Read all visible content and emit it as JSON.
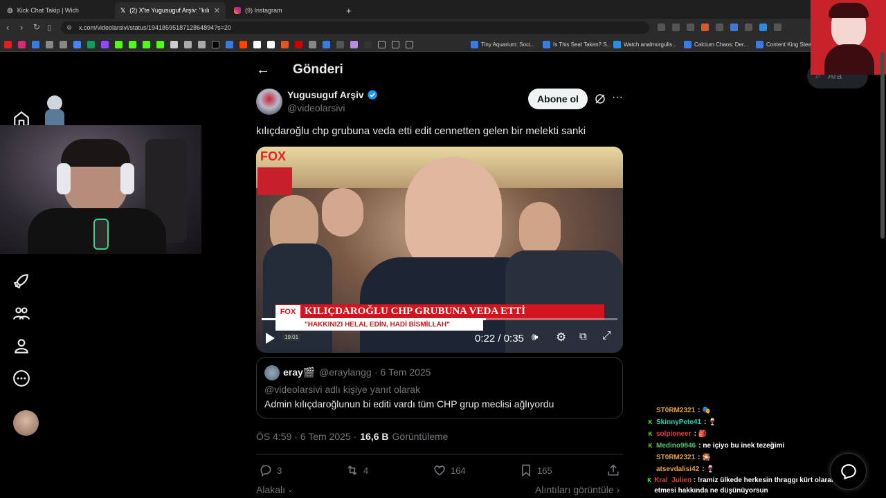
{
  "browser": {
    "tabs": [
      {
        "title": "Kick Chat Takip | Wich",
        "active": false
      },
      {
        "title": "(2) X'te Yugusuguf Arşiv: \"kılıçda",
        "active": true
      },
      {
        "title": "(9) Instagram",
        "active": false
      }
    ],
    "new_tab": "+",
    "url": "x.com/videolarsivi/status/1941859518712864894?s=20",
    "bookmarks": [
      {
        "label": "Tiny Aquarium: Soci..."
      },
      {
        "label": "Is This Seat Taken? S..."
      },
      {
        "label": "Watch analmorgulis..."
      },
      {
        "label": "Calcium Chaos: Der..."
      },
      {
        "label": "Content King Stean"
      }
    ]
  },
  "colors": {
    "accent": "#1d9bf0",
    "verified": "#1d9bf0",
    "muted": "#71767b",
    "red_banner": "#d3141e",
    "portrait_red": "#c8232a"
  },
  "header": {
    "back_icon": "arrow-left-icon",
    "title": "Gönderi"
  },
  "search": {
    "placeholder": "Ara"
  },
  "post": {
    "author_name": "Yugusuguf Arşiv",
    "author_handle": "@videolarsivi",
    "subscribe_label": "Abone ol",
    "text": "kılıçdaroğlu chp grubuna veda etti edit cennetten gelen bir melekti sanki",
    "video": {
      "channel_logo": "FOX",
      "banner_title": "KILIÇDAROĞLU CHP GRUBUNA VEDA ETTİ",
      "banner_subtitle": "\"HAKKINIZI HELAL EDİN, HADİ BİSMİLLAH\"",
      "clock": "19:01",
      "time": "0:22 / 0:35",
      "progress": 0.63
    },
    "quote": {
      "name": "eray🎬",
      "handle": "@eraylangg",
      "date": "· 6 Tem 2025",
      "reply_to": "@videolarsivi adlı kişiye yanıt olarak",
      "text": "Admin kılıçdaroğlunun bi editi vardı tüm CHP grup meclisi ağlıyordu"
    },
    "timestamp": "ÖS 4:59 · 6 Tem 2025 ·",
    "views_count": "16,6 B",
    "views_label": "Görüntüleme",
    "actions": {
      "replies": "3",
      "reposts": "4",
      "likes": "164",
      "bookmarks": "165"
    },
    "related_left": "Alakalı",
    "related_right": "Alıntıları görüntüle"
  },
  "chat": [
    {
      "user": "ST0RM2321",
      "color": "#e5a23b",
      "badge": "",
      "msg": " : 🎭"
    },
    {
      "user": "SkinnyPete41",
      "color": "#1fd4b4",
      "badge": "K",
      "msg": " : 🍷"
    },
    {
      "user": "solpioneer",
      "color": "#e53d3d",
      "badge": "K",
      "msg": " : 🎒"
    },
    {
      "user": "Medino9846",
      "color": "#53c26b",
      "badge": "K",
      "msg": " : ne içiyo bu inek tezeğimi"
    },
    {
      "user": "ST0RM2321",
      "color": "#e5a23b",
      "badge": "",
      "msg": " : 🎇"
    },
    {
      "user": "atsevdalisi42",
      "color": "#e5a23b",
      "badge": "",
      "msg": " : 🍷"
    },
    {
      "user": "Kral_Julien",
      "color": "#e53d3d",
      "badge": "K",
      "msg": " : !ramiz ülkede herkesin thraggı kürt olarak kabul etmesi hakkında ne düşünüyorsun"
    }
  ]
}
